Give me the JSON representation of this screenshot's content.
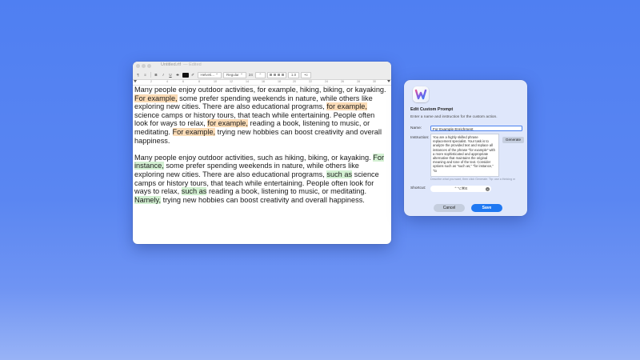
{
  "editor": {
    "title": "Untitled.rtf",
    "edited": "— Edited",
    "toolbar": {
      "paragraph_glyph": "¶",
      "list_glyph": "≡",
      "bold": "B",
      "italic": "I",
      "underline": "U",
      "strike": "S",
      "text_color": "#111111",
      "font_family": "Helveti...",
      "font_style": "Regular",
      "font_size": "24",
      "spacing": "1.0",
      "list_style": "•≡"
    },
    "ruler_ticks": [
      "0",
      "2",
      "4",
      "6",
      "8",
      "10",
      "12",
      "14",
      "16",
      "18",
      "20",
      "22",
      "24",
      "26",
      "28",
      "30"
    ],
    "paragraph1": [
      {
        "text": "Many people enjoy outdoor activities, for example, hiking, biking, or kayaking. ",
        "hl": ""
      },
      {
        "text": "For example,",
        "hl": "orange"
      },
      {
        "text": " some prefer spending weekends in nature, while others like exploring new cities. There are also educational programs, ",
        "hl": ""
      },
      {
        "text": "for example,",
        "hl": "orange"
      },
      {
        "text": " science camps or history tours, that teach while entertaining. People often look for ways to relax, ",
        "hl": ""
      },
      {
        "text": "for example,",
        "hl": "orange"
      },
      {
        "text": " reading a book, listening to music, or meditating. ",
        "hl": ""
      },
      {
        "text": "For example,",
        "hl": "orange"
      },
      {
        "text": " trying new hobbies can boost creativity and overall happiness.",
        "hl": ""
      }
    ],
    "paragraph2": [
      {
        "text": "Many people enjoy outdoor activities, such as hiking, biking, or kayaking. ",
        "hl": ""
      },
      {
        "text": "For instance,",
        "hl": "green"
      },
      {
        "text": " some prefer spending weekends in nature, while others like exploring new cities. There are also educational programs, ",
        "hl": ""
      },
      {
        "text": "such as",
        "hl": "green"
      },
      {
        "text": " science camps or history tours, that teach while entertaining. People often look for ways to relax, ",
        "hl": ""
      },
      {
        "text": "such as",
        "hl": "green"
      },
      {
        "text": " reading a book, listening to music, or meditating. ",
        "hl": ""
      },
      {
        "text": "Namely,",
        "hl": "green"
      },
      {
        "text": " trying new hobbies can boost creativity and overall happiness.",
        "hl": ""
      }
    ]
  },
  "dialog": {
    "title": "Edit Custom Prompt",
    "subtitle": "Enter a name and instruction for the custom action.",
    "name_label": "Name:",
    "name_value": "For Example Enrichment",
    "instruction_label": "Instruction:",
    "instruction_text": "You are a highly skilled phrase replacement specialist. Your task is to analyze the provided text and replace all instances of the phrase \"for example\" with a more sophisticated and appropriate alternative that maintains the original meaning and tone of the text. Consider options such as \"such as,\" \"for instance,\" \"to",
    "generate_label": "Generate",
    "hint": "Describe what you want, then click Generate. Tip: use a thinking m",
    "shortcut_label": "Shortcut:",
    "shortcut_value": "⌃⌥⌘E",
    "clear_glyph": "×",
    "cancel_label": "Cancel",
    "save_label": "Save"
  },
  "colors": {
    "highlight_orange": "#fbdcb7",
    "highlight_green": "#d4f1d3",
    "accent": "#1f78f2"
  }
}
